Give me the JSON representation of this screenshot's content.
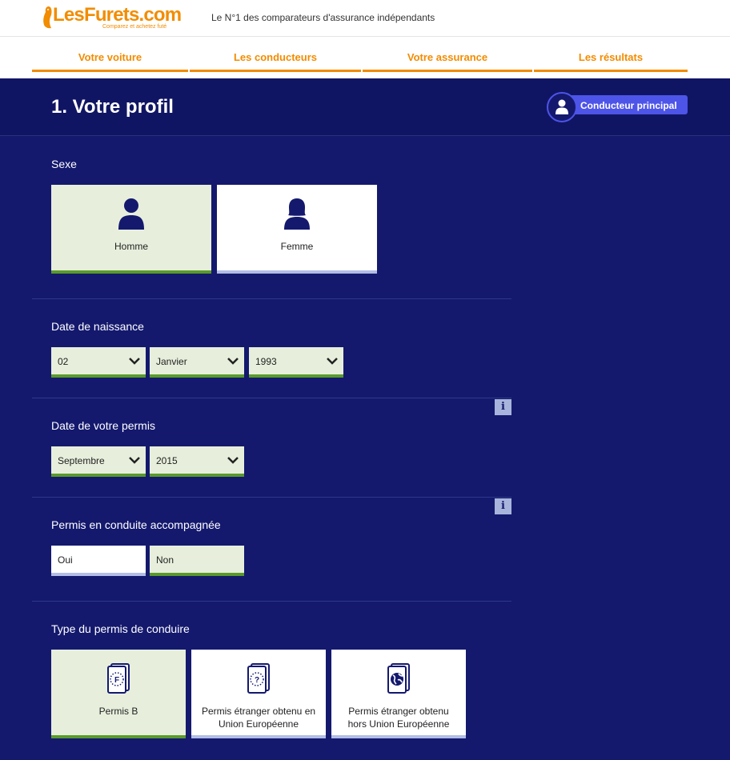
{
  "header": {
    "brand": "LesFurets.com",
    "tagline": "Comparez et achetez futé",
    "slogan": "Le N°1 des comparateurs d'assurance indépendants"
  },
  "steps": [
    {
      "label": "Votre voiture"
    },
    {
      "label": "Les conducteurs"
    },
    {
      "label": "Votre assurance"
    },
    {
      "label": "Les résultats"
    }
  ],
  "page": {
    "title": "1. Votre profil",
    "driver_badge": "Conducteur principal"
  },
  "sexe": {
    "label": "Sexe",
    "options": [
      {
        "label": "Homme",
        "selected": true,
        "icon": "man-icon"
      },
      {
        "label": "Femme",
        "selected": false,
        "icon": "woman-icon"
      }
    ]
  },
  "birthdate": {
    "label": "Date de naissance",
    "day": "02",
    "month": "Janvier",
    "year": "1993"
  },
  "licence_date": {
    "label": "Date de votre permis",
    "month": "Septembre",
    "year": "2015",
    "info_icon": "i"
  },
  "accompanied": {
    "label": "Permis en conduite accompagnée",
    "info_icon": "i",
    "options": [
      {
        "label": "Oui",
        "selected": false
      },
      {
        "label": "Non",
        "selected": true
      }
    ]
  },
  "licence_type": {
    "label": "Type du permis de conduire",
    "options": [
      {
        "label": "Permis B",
        "selected": true,
        "icon": "french-licence-icon",
        "glyph": "F"
      },
      {
        "label": "Permis étranger obtenu en Union Européenne",
        "line1": "Permis étranger obtenu en",
        "line2": "Union Européenne",
        "selected": false,
        "icon": "eu-licence-icon",
        "glyph": "?"
      },
      {
        "label": "Permis étranger obtenu hors Union Européenne",
        "line1": "Permis étranger obtenu",
        "line2": "hors Union Européenne",
        "selected": false,
        "icon": "world-licence-icon"
      }
    ]
  },
  "colors": {
    "background": "#14196e",
    "accent_orange": "#f28c00",
    "selected_green": "#5a9a2b",
    "badge_blue": "#4d54e8"
  }
}
